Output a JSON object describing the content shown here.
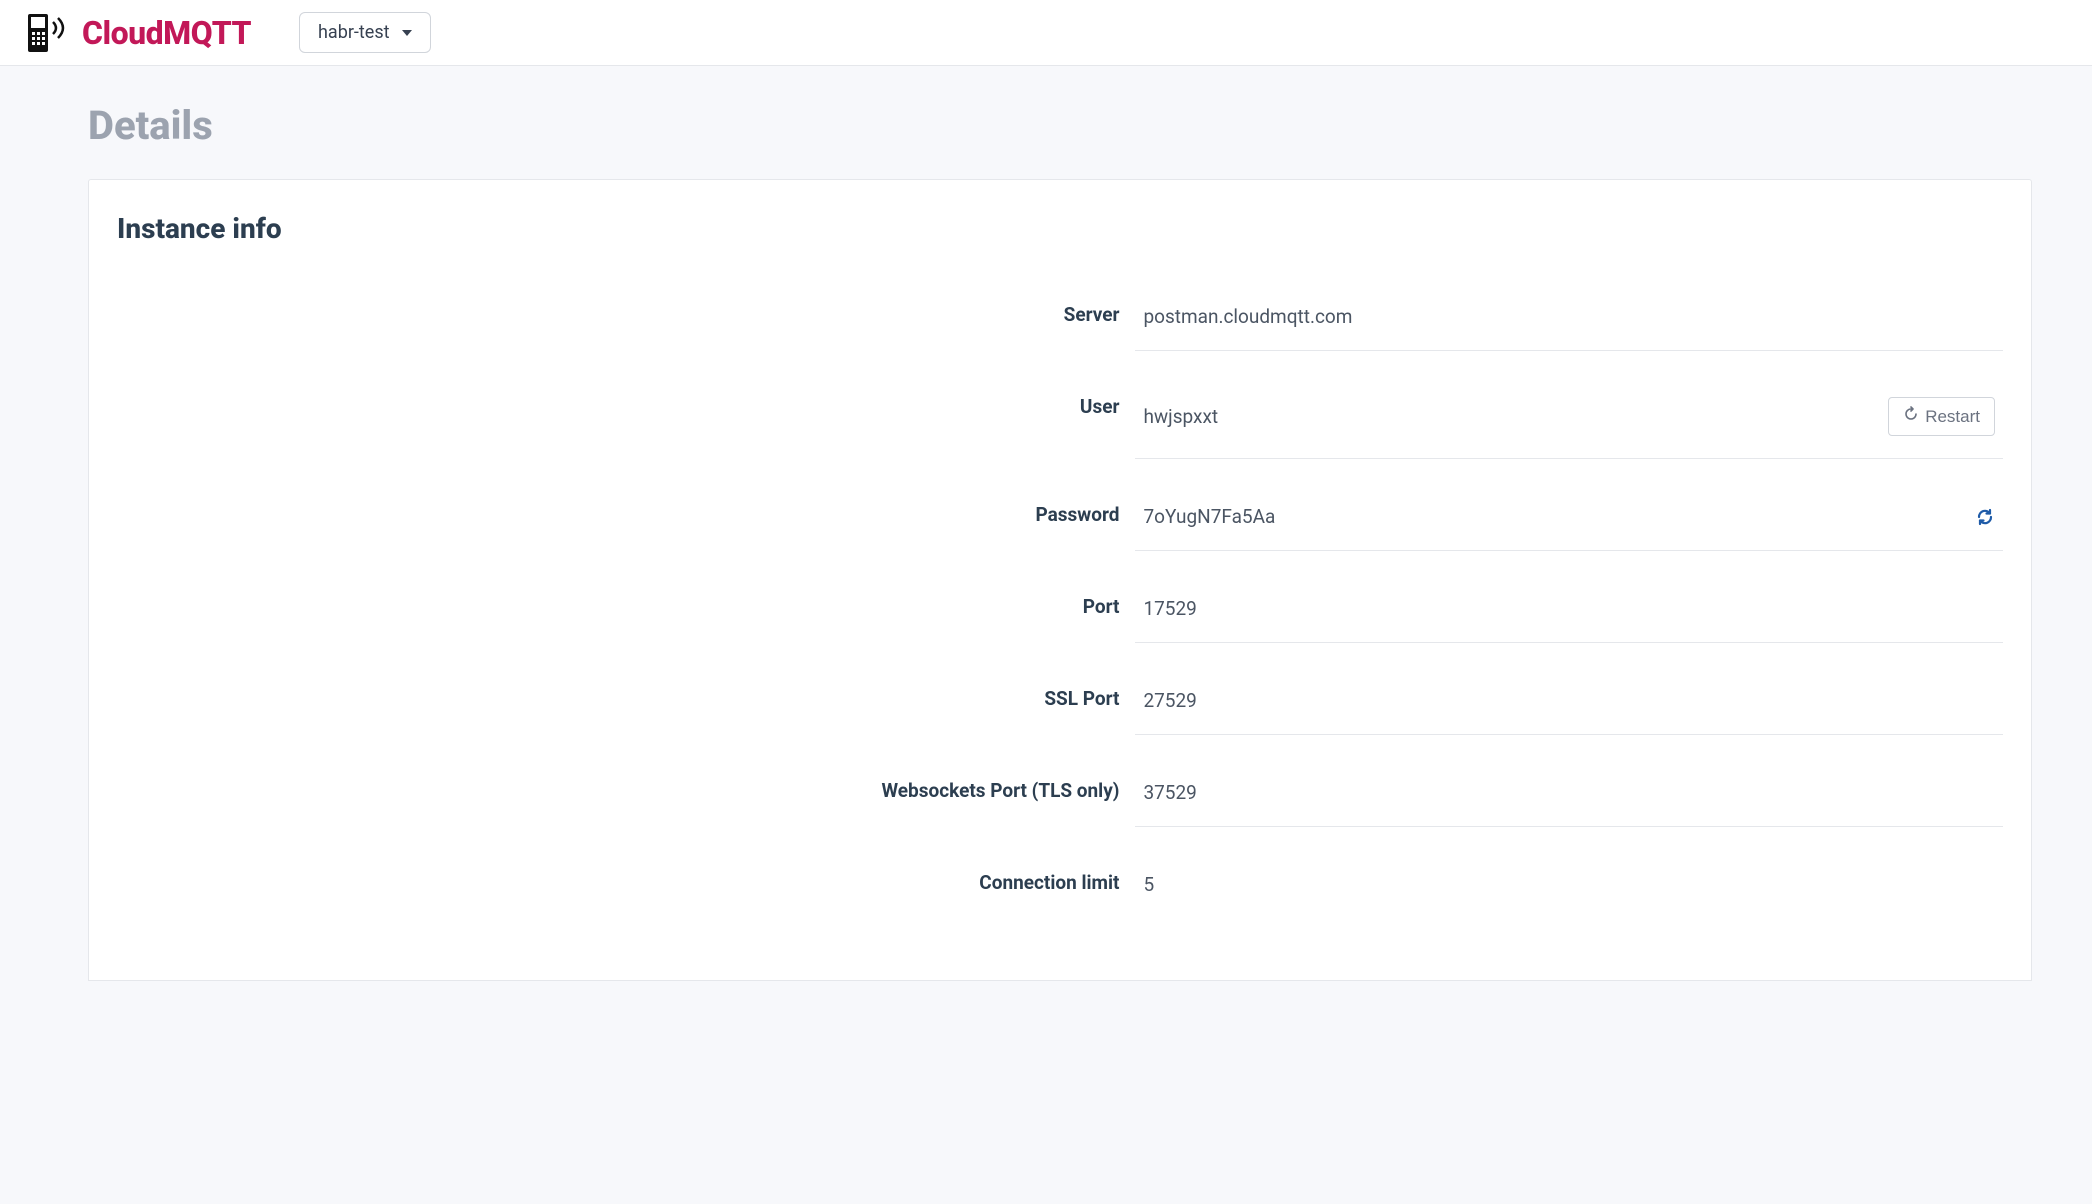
{
  "brand": {
    "name": "CloudMQTT"
  },
  "instanceSelector": {
    "selected": "habr-test"
  },
  "page": {
    "title": "Details"
  },
  "card": {
    "title": "Instance info",
    "rows": {
      "server": {
        "label": "Server",
        "value": "postman.cloudmqtt.com"
      },
      "user": {
        "label": "User",
        "value": "hwjspxxt",
        "restartLabel": "Restart"
      },
      "password": {
        "label": "Password",
        "value": "7oYugN7Fa5Aa"
      },
      "port": {
        "label": "Port",
        "value": "17529"
      },
      "sslPort": {
        "label": "SSL Port",
        "value": "27529"
      },
      "wsPort": {
        "label": "Websockets Port (TLS only)",
        "value": "37529"
      },
      "connLimit": {
        "label": "Connection limit",
        "value": "5"
      }
    }
  }
}
